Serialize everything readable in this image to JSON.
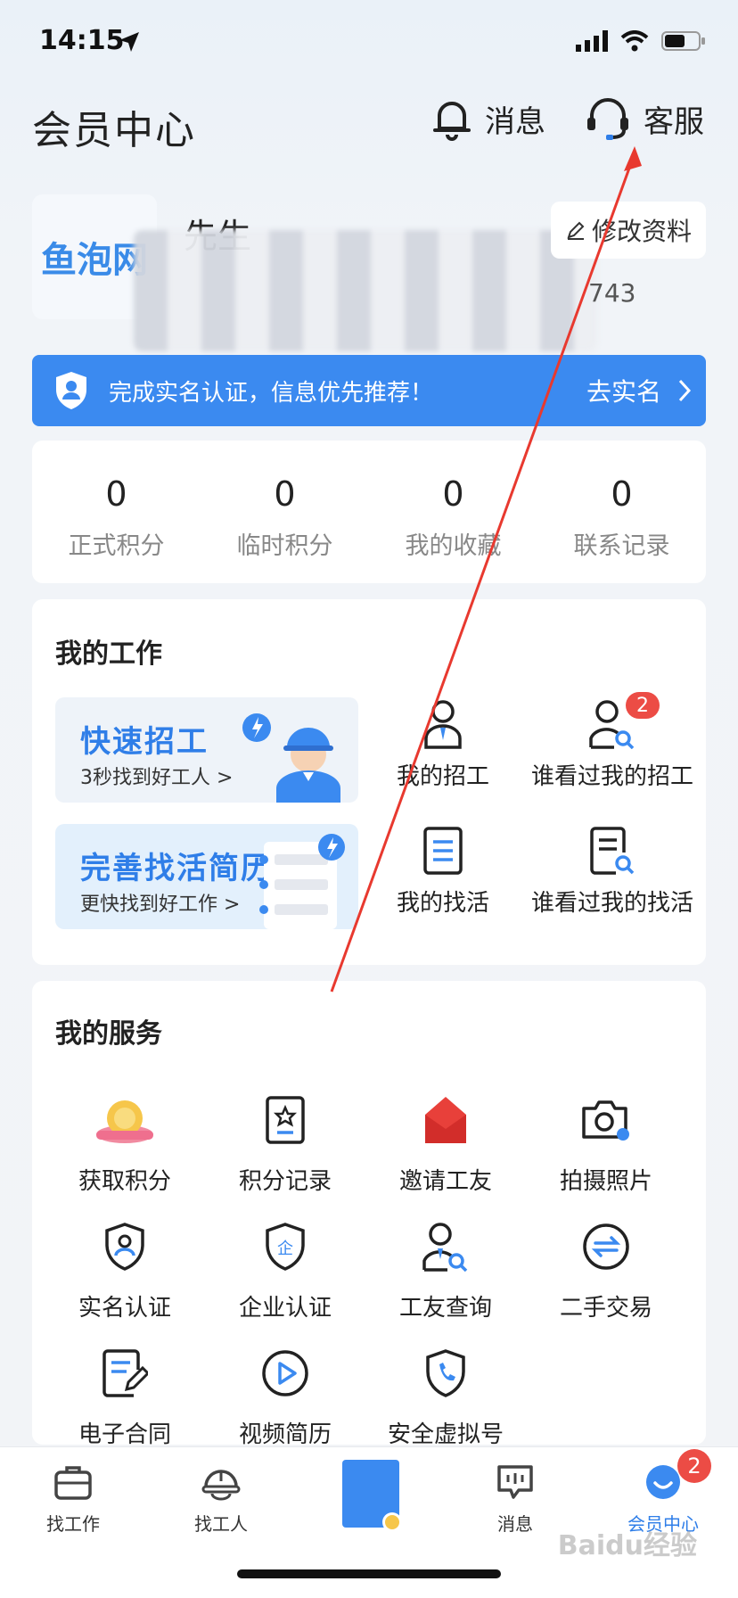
{
  "status_bar": {
    "time": "14:15"
  },
  "header": {
    "title": "会员中心",
    "messages_label": "消息",
    "service_label": "客服"
  },
  "profile": {
    "avatar_text": "鱼泡网",
    "name": "先生",
    "phone_suffix": "743",
    "edit_label": "修改资料"
  },
  "verify_banner": {
    "message": "完成实名认证，信息优先推荐！",
    "cta": "去实名"
  },
  "stats": [
    {
      "value": "0",
      "label": "正式积分"
    },
    {
      "value": "0",
      "label": "临时积分"
    },
    {
      "value": "0",
      "label": "我的收藏"
    },
    {
      "value": "0",
      "label": "联系记录"
    }
  ],
  "my_work": {
    "title": "我的工作",
    "promo_hire": {
      "title": "快速招工",
      "subtitle": "3秒找到好工人 >"
    },
    "promo_resume": {
      "title": "完善找活简历",
      "subtitle": "更快找到好工作 >"
    },
    "items": [
      {
        "label": "我的招工"
      },
      {
        "label": "谁看过我的招工",
        "badge": "2"
      },
      {
        "label": "我的找活"
      },
      {
        "label": "谁看过我的找活"
      }
    ]
  },
  "my_services": {
    "title": "我的服务",
    "items": [
      {
        "label": "获取积分",
        "icon": "coin-icon"
      },
      {
        "label": "积分记录",
        "icon": "record-icon"
      },
      {
        "label": "邀请工友",
        "icon": "red-envelope-icon"
      },
      {
        "label": "拍摄照片",
        "icon": "camera-icon"
      },
      {
        "label": "实名认证",
        "icon": "id-shield-icon"
      },
      {
        "label": "企业认证",
        "icon": "enterprise-shield-icon"
      },
      {
        "label": "工友查询",
        "icon": "user-search-icon"
      },
      {
        "label": "二手交易",
        "icon": "exchange-icon"
      },
      {
        "label": "电子合同",
        "icon": "contract-icon"
      },
      {
        "label": "视频简历",
        "icon": "play-icon"
      },
      {
        "label": "安全虚拟号",
        "icon": "phone-shield-icon"
      }
    ]
  },
  "tabbar": {
    "items": [
      {
        "label": "找工作",
        "icon": "briefcase-icon"
      },
      {
        "label": "找工人",
        "icon": "helmet-icon"
      },
      {
        "label": "",
        "icon": "center-card-icon"
      },
      {
        "label": "消息",
        "icon": "chat-icon"
      },
      {
        "label": "会员中心",
        "icon": "smile-icon",
        "badge": "2",
        "active": true
      }
    ]
  },
  "watermark": "Baidu经验",
  "colors": {
    "accent": "#3b8af0",
    "badge": "#ec4c45",
    "annotation": "#e8392f"
  }
}
